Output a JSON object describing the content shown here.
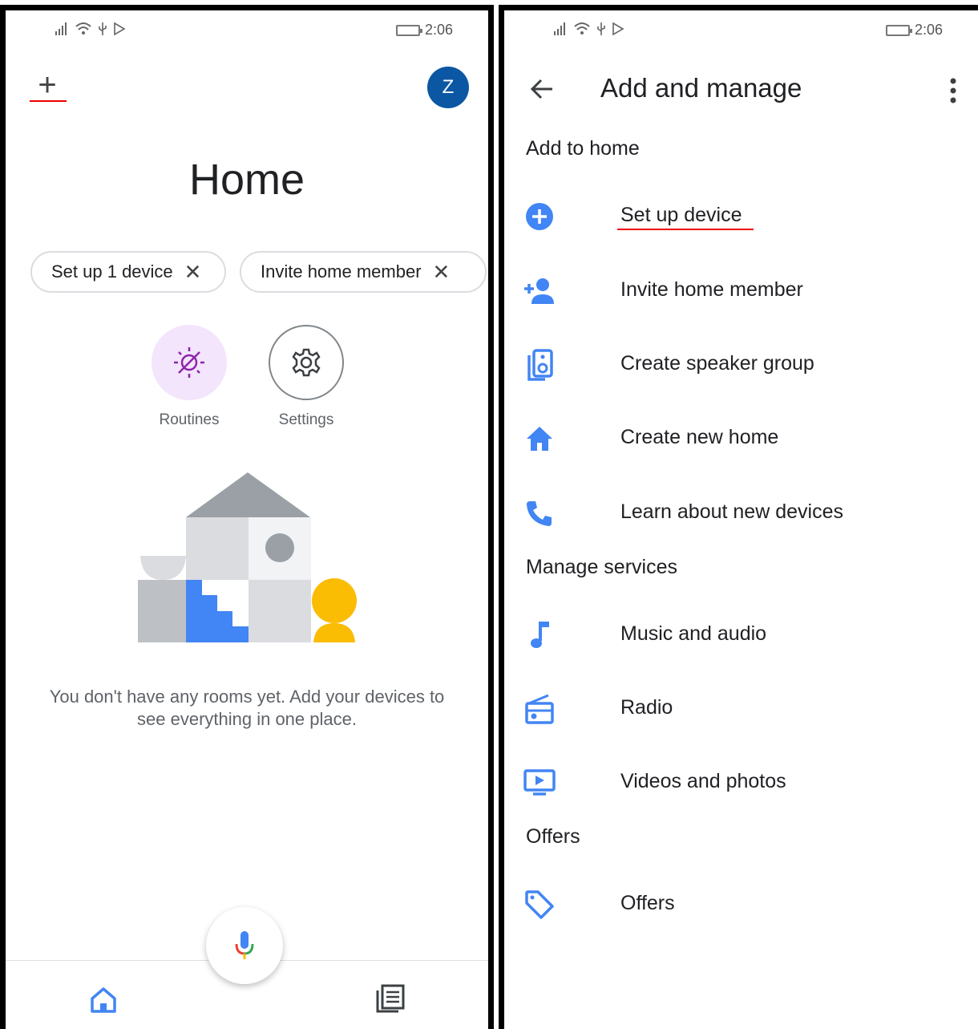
{
  "status_bar": {
    "time": "2:06"
  },
  "left": {
    "title": "Home",
    "avatar_letter": "Z",
    "chips": [
      {
        "label": "Set up 1 device"
      },
      {
        "label": "Invite home member"
      }
    ],
    "shortcuts": [
      {
        "label": "Routines",
        "icon": "routines-icon"
      },
      {
        "label": "Settings",
        "icon": "gear-icon"
      }
    ],
    "empty_message": "You don't have any rooms yet. Add your devices to see everything in one place.",
    "close_glyph": "✕"
  },
  "right": {
    "title": "Add and manage",
    "sections": [
      {
        "title": "Add to home",
        "items": [
          {
            "label": "Set up device",
            "icon": "add-circle-icon"
          },
          {
            "label": "Invite home member",
            "icon": "person-add-icon"
          },
          {
            "label": "Create speaker group",
            "icon": "speaker-icon"
          },
          {
            "label": "Create new home",
            "icon": "home-icon"
          },
          {
            "label": "Learn about new devices",
            "icon": "phone-icon"
          }
        ]
      },
      {
        "title": "Manage services",
        "items": [
          {
            "label": "Music and audio",
            "icon": "music-note-icon"
          },
          {
            "label": "Radio",
            "icon": "radio-icon"
          },
          {
            "label": "Videos and photos",
            "icon": "video-icon"
          }
        ]
      },
      {
        "title": "Offers",
        "items": [
          {
            "label": "Offers",
            "icon": "tag-icon"
          }
        ]
      }
    ]
  },
  "colors": {
    "accent": "#4285f4",
    "avatar": "#0b57a3",
    "annotation": "#ee0000"
  }
}
